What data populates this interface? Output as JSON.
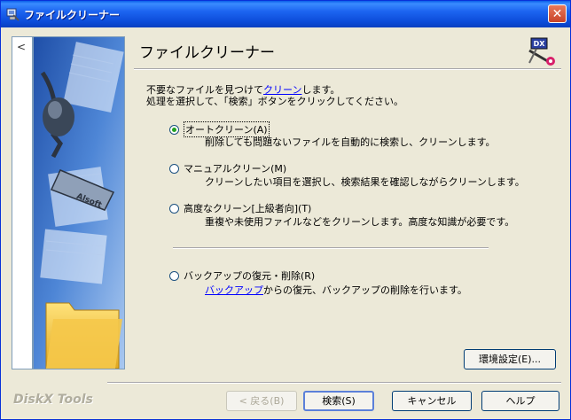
{
  "window": {
    "title": "ファイルクリーナー"
  },
  "header": {
    "title": "ファイルクリーナー"
  },
  "intro": {
    "line1_before": "不要なファイルを見つけて",
    "line1_link": "クリーン",
    "line1_after": "します。",
    "line2": "処理を選択して、「検索」ボタンをクリックしてください。"
  },
  "options": [
    {
      "label": "オートクリーン(A)",
      "desc": "削除しても問題ないファイルを自動的に検索し、クリーンします。",
      "checked": true
    },
    {
      "label": "マニュアルクリーン(M)",
      "desc": "クリーンしたい項目を選択し、検索結果を確認しながらクリーンします。",
      "checked": false
    },
    {
      "label": "高度なクリーン[上級者向](T)",
      "desc": "重複や未使用ファイルなどをクリーンします。高度な知識が必要です。",
      "checked": false
    },
    {
      "label": "バックアップの復元・削除(R)",
      "desc_link": "バックアップ",
      "desc": "からの復元、バックアップの削除を行います。",
      "checked": false
    }
  ],
  "buttons": {
    "settings": "環境設定(E)...",
    "back": "< 戻る(B)",
    "search": "検索(S)",
    "cancel": "キャンセル",
    "help": "ヘルプ"
  },
  "brand": "DiskX Tools",
  "image_text": "Alsoft",
  "logo_text": "DX",
  "colors": {
    "titlebar": "#0A5EE8",
    "link": "#0000FF",
    "background": "#ECE9D8"
  }
}
